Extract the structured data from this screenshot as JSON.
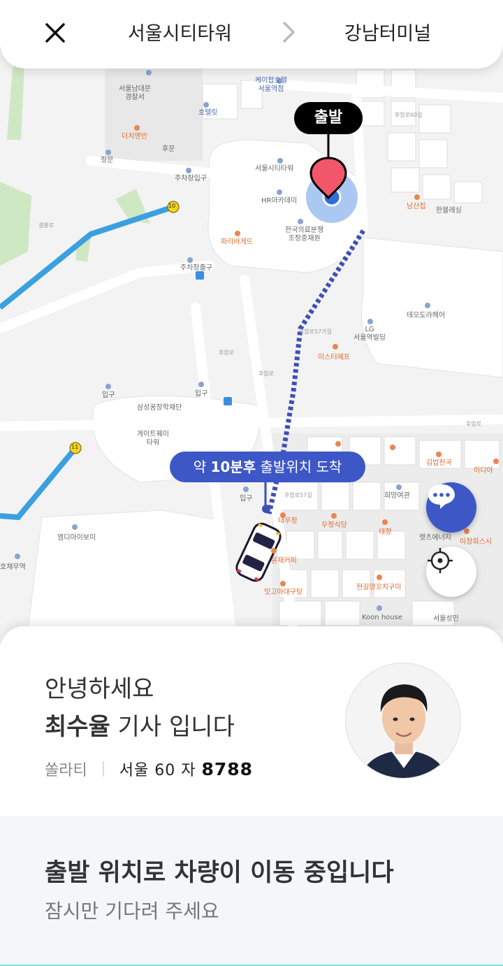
{
  "header": {
    "origin": "서울시티타워",
    "destination": "강남터미널",
    "close_icon": "close-icon",
    "arrow_icon": "chevron-right-icon"
  },
  "map": {
    "depart_tag": "출발",
    "eta": {
      "prefix": "약 ",
      "time": "10분후",
      "suffix": " 출발위치 도착"
    },
    "labels": {
      "police": "서울남대문\n경찰서",
      "hotel_top": "케이팝호텔\n서울역점",
      "hotelit": "호텔릿",
      "dutch": "더치앤빈",
      "jeongmun": "정문",
      "humun": "후문",
      "parking_in": "주차장입구",
      "parking_out": "주차장출구",
      "tower": "서울시티타워",
      "hr": "HR아카데미",
      "kmd": "한국의료분쟁\n조정중재원",
      "paris": "파리바게뜨",
      "namsan": "남산집",
      "hanbl": "한블레싱",
      "teo": "테오도라헤어",
      "lg": "LG\n서울역빌딩",
      "mister": "미스터에프",
      "ipgu1": "입구",
      "ipgu2": "입구",
      "ipgu3": "입구",
      "samsung": "삼성꿈장학재단",
      "gateway": "게이트웨이\n타워",
      "hope": "희망여관",
      "kimbap": "김밥천국",
      "idai": "이디야",
      "daewoo": "대우정",
      "woojung": "우정식당",
      "taehyang": "태향",
      "lets": "렛츠에너지",
      "ichang": "이창희스시",
      "yoonjae": "윤재커피",
      "mitgoma": "밋고마대구탕",
      "hyeongil": "현길양꼬치구이",
      "koon": "Koon house",
      "seoul_sungmin": "서울성민",
      "mdiab": "엠디아이보이",
      "hochae": "호채무역",
      "bus10": "10",
      "bus11": "11",
      "road_humyang": "후암로",
      "road_57": "후암로57길",
      "road_57ga": "후암로57가길",
      "road_60": "후암로60길",
      "gyeol": "결흥로"
    }
  },
  "buttons": {
    "chat_icon": "chat-bubble-icon",
    "locate_icon": "crosshair-icon"
  },
  "driver": {
    "greeting": "안녕하세요",
    "name": "최수율",
    "suffix": " 기사 입니다",
    "car_model": "쏠라티",
    "plate_prefix": "서울 60 자",
    "plate_number": "8788"
  },
  "status": {
    "title": "출발 위치로 차량이 이동 중입니다",
    "subtitle": "잠시만 기다려 주세요"
  },
  "colors": {
    "accent": "#3e57c6",
    "pin": "#f2566b",
    "route_blue": "#3aa0e0",
    "dots": "#3e4fb8",
    "bottom_line": "#7ee8e0"
  }
}
